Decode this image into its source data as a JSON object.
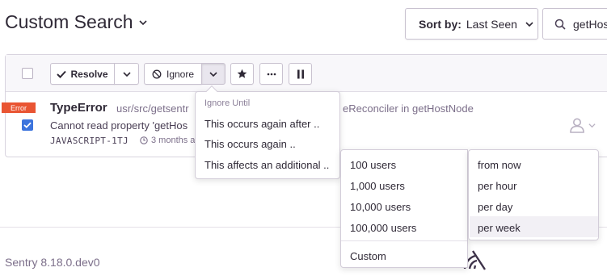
{
  "header": {
    "title": "Custom Search",
    "sort_label": "Sort by:",
    "sort_value": "Last Seen",
    "search_value": "getHos"
  },
  "toolbar": {
    "resolve_label": "Resolve",
    "ignore_label": "Ignore"
  },
  "issue": {
    "level": "Error",
    "title": "TypeError",
    "path_start": "usr/src/getsentr",
    "path_end": "eReconciler in getHostNode",
    "message": "Cannot read property 'getHos",
    "short_id": "JAVASCRIPT-1TJ",
    "time": "3 months a"
  },
  "ignore_menu": {
    "header": "Ignore Until",
    "items": [
      "This occurs again after ..",
      "This occurs again ..",
      "This affects an additional .."
    ]
  },
  "users_menu": {
    "items": [
      "100 users",
      "1,000 users",
      "10,000 users",
      "100,000 users"
    ],
    "custom": "Custom"
  },
  "period_menu": {
    "items": [
      "from now",
      "per hour",
      "per day",
      "per week"
    ],
    "highlighted": "per week"
  },
  "footer": {
    "version": "Sentry 8.18.0.dev0"
  },
  "colors": {
    "accent_blue": "#3c74dd",
    "error_badge": "#e95533",
    "text_primary": "#2f2936",
    "text_muted": "#7c6f8a"
  }
}
